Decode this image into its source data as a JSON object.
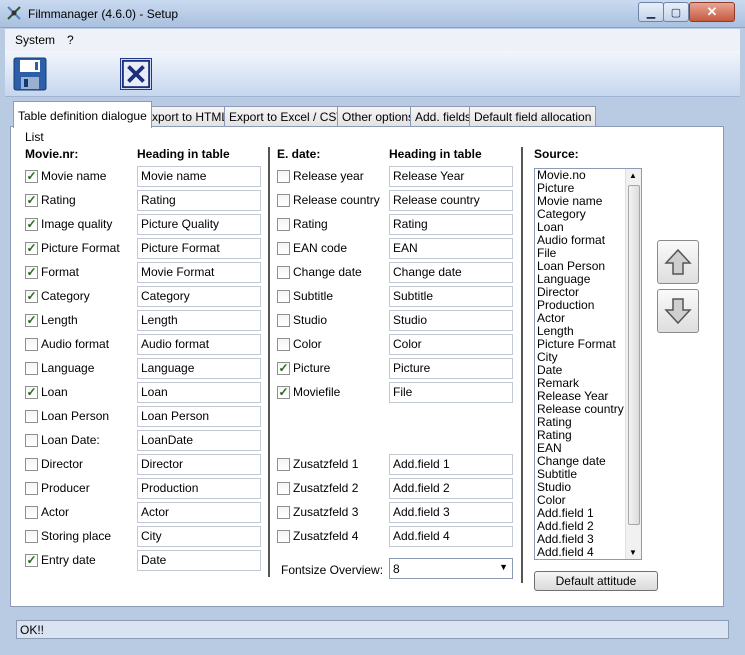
{
  "window": {
    "title": "Filmmanager (4.6.0) - Setup"
  },
  "menu": {
    "system": "System",
    "help": "?"
  },
  "tabs": [
    {
      "label": "Table definition dialogue",
      "active": true
    },
    {
      "label": "Export to HTML"
    },
    {
      "label": "Export to Excel / CSV"
    },
    {
      "label": "Other options"
    },
    {
      "label": "Add. fields"
    },
    {
      "label": "Default field allocation"
    }
  ],
  "panel": {
    "list_label": "List",
    "col1_header": "Movie.nr:",
    "col2_header": "Heading in table",
    "col3_header": "E. date:",
    "col4_header": "Heading in table",
    "source_header": "Source:",
    "left_rows": [
      {
        "label": "Movie name",
        "checked": true,
        "value": "Movie name"
      },
      {
        "label": "Rating",
        "checked": true,
        "value": "Rating"
      },
      {
        "label": "Image quality",
        "checked": true,
        "value": "Picture Quality"
      },
      {
        "label": "Picture Format",
        "checked": true,
        "value": "Picture Format"
      },
      {
        "label": "Format",
        "checked": true,
        "value": "Movie Format"
      },
      {
        "label": "Category",
        "checked": true,
        "value": "Category"
      },
      {
        "label": "Length",
        "checked": true,
        "value": "Length"
      },
      {
        "label": "Audio format",
        "checked": false,
        "value": "Audio format"
      },
      {
        "label": "Language",
        "checked": false,
        "value": "Language"
      },
      {
        "label": "Loan",
        "checked": true,
        "value": "Loan"
      },
      {
        "label": "Loan Person",
        "checked": false,
        "value": "Loan Person"
      },
      {
        "label": "Loan Date:",
        "checked": false,
        "value": "LoanDate"
      },
      {
        "label": "Director",
        "checked": false,
        "value": "Director"
      },
      {
        "label": "Producer",
        "checked": false,
        "value": "Production"
      },
      {
        "label": "Actor",
        "checked": false,
        "value": "Actor"
      },
      {
        "label": "Storing place",
        "checked": false,
        "value": "City"
      },
      {
        "label": "Entry date",
        "checked": true,
        "value": "Date"
      }
    ],
    "right_rows": [
      {
        "label": "Release year",
        "checked": false,
        "value": "Release Year"
      },
      {
        "label": "Release country",
        "checked": false,
        "value": "Release country"
      },
      {
        "label": "Rating",
        "checked": false,
        "value": "Rating"
      },
      {
        "label": "EAN code",
        "checked": false,
        "value": "EAN"
      },
      {
        "label": "Change date",
        "checked": false,
        "value": "Change date"
      },
      {
        "label": "Subtitle",
        "checked": false,
        "value": "Subtitle"
      },
      {
        "label": "Studio",
        "checked": false,
        "value": "Studio"
      },
      {
        "label": "Color",
        "checked": false,
        "value": "Color"
      },
      {
        "label": "Picture",
        "checked": true,
        "value": "Picture"
      },
      {
        "label": "Moviefile",
        "checked": true,
        "value": "File"
      }
    ],
    "extra_rows": [
      {
        "label": "Zusatzfeld 1",
        "checked": false,
        "value": "Add.field 1"
      },
      {
        "label": "Zusatzfeld 2",
        "checked": false,
        "value": "Add.field 2"
      },
      {
        "label": "Zusatzfeld 3",
        "checked": false,
        "value": "Add.field 3"
      },
      {
        "label": "Zusatzfeld 4",
        "checked": false,
        "value": "Add.field 4"
      }
    ],
    "fontsize_label": "Fontsize Overview:",
    "fontsize_value": "8",
    "source_items": [
      "Movie.no",
      "Picture",
      "Movie name",
      "Category",
      "Loan",
      "Audio format",
      "File",
      "Loan Person",
      "Language",
      "Director",
      "Production",
      "Actor",
      "Length",
      "Picture Format",
      "City",
      "Date",
      "Remark",
      "Release Year",
      "Release country",
      "Rating",
      "Rating",
      "EAN",
      "Change date",
      "Subtitle",
      "Studio",
      "Color",
      "Add.field 1",
      "Add.field 2",
      "Add.field 3",
      "Add.field 4"
    ],
    "default_button": "Default attitude"
  },
  "status": {
    "text": "OK!!"
  },
  "colors": {
    "accent": "#b9cbe2",
    "close_button": "#c75a3f",
    "check_mark": "#2a6b1e"
  }
}
